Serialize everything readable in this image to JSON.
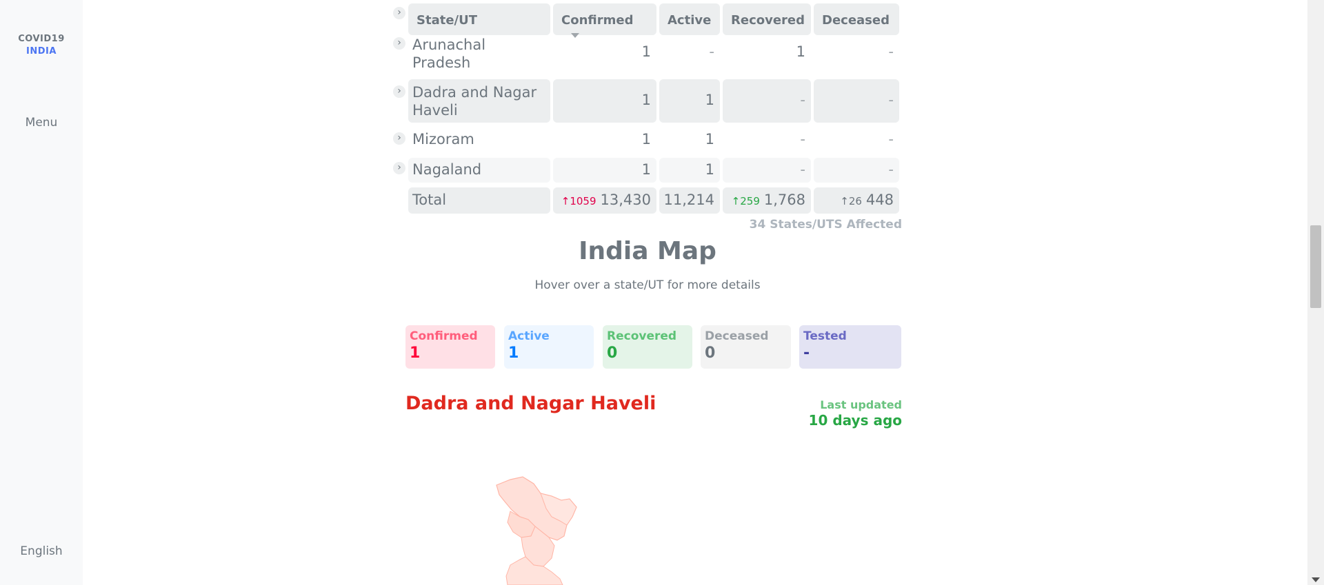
{
  "sidebar": {
    "logo_line1": "COVID19",
    "logo_line2": "INDIA",
    "menu": "Menu",
    "language": "English"
  },
  "table": {
    "headers": [
      "State/UT",
      "Confirmed",
      "Active",
      "Recovered",
      "Deceased"
    ],
    "rows": [
      {
        "name_line1": "Arunachal",
        "name_line2": "Pradesh",
        "confirmed": "1",
        "active": "-",
        "recovered": "1",
        "deceased": "-"
      },
      {
        "name_line1": "Dadra and Nagar",
        "name_line2": "Haveli",
        "confirmed": "1",
        "active": "1",
        "recovered": "-",
        "deceased": "-"
      },
      {
        "name_line1": "Mizoram",
        "name_line2": "",
        "confirmed": "1",
        "active": "1",
        "recovered": "-",
        "deceased": "-"
      },
      {
        "name_line1": "Nagaland",
        "name_line2": "",
        "confirmed": "1",
        "active": "1",
        "recovered": "-",
        "deceased": "-"
      }
    ],
    "total": {
      "label": "Total",
      "confirmed_delta": "1059",
      "confirmed": "13,430",
      "active": "11,214",
      "recovered_delta": "259",
      "recovered": "1,768",
      "deceased_delta": "26",
      "deceased": "448"
    },
    "affected": "34 States/UTS Affected"
  },
  "map_section": {
    "title": "India Map",
    "subtitle": "Hover over a state/UT for more details",
    "stats": {
      "confirmed_label": "Confirmed",
      "confirmed_value": "1",
      "active_label": "Active",
      "active_value": "1",
      "recovered_label": "Recovered",
      "recovered_value": "0",
      "deceased_label": "Deceased",
      "deceased_value": "0",
      "tested_label": "Tested",
      "tested_value": "-"
    },
    "state_name": "Dadra and Nagar Haveli",
    "last_updated_label": "Last updated",
    "last_updated_value": "10 days ago"
  },
  "colors": {
    "confirmed": "#ff073a",
    "active": "#007bff",
    "recovered": "#28a745",
    "deceased": "#6c757d",
    "tested": "#3f3f9f",
    "map_fill": "#ffe0d9"
  }
}
